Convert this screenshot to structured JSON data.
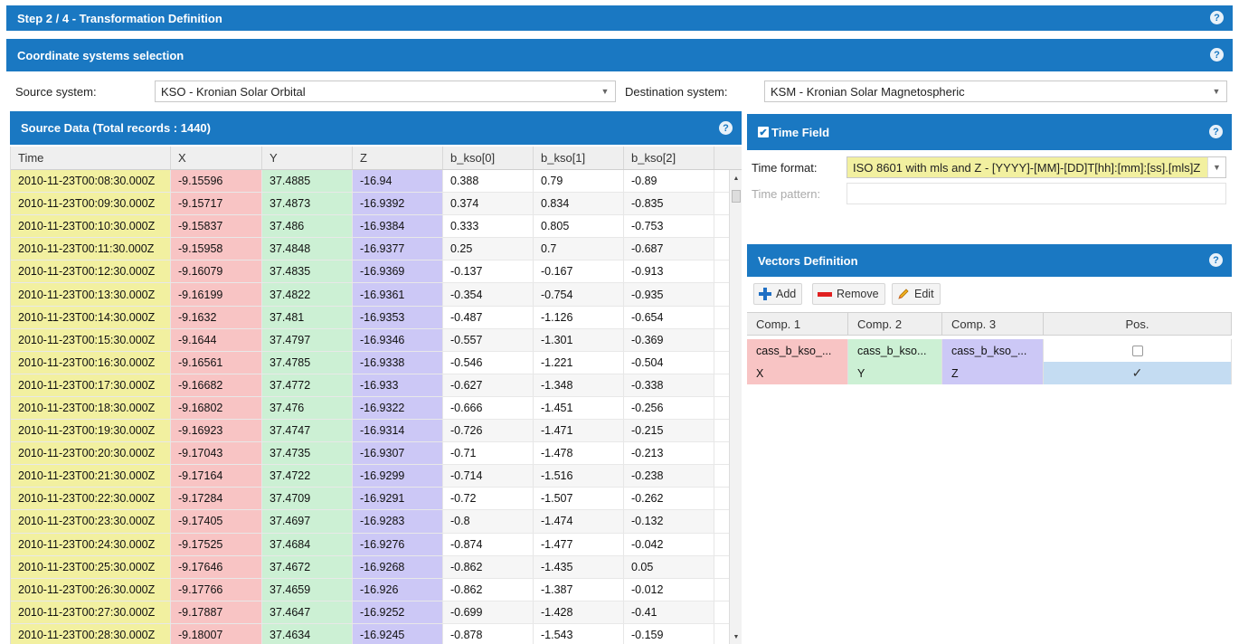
{
  "step": {
    "title": "Step 2 / 4 - Transformation Definition",
    "help": "?"
  },
  "coord": {
    "title": "Coordinate systems selection",
    "help": "?",
    "source_label": "Source system:",
    "source_value": "KSO - Kronian Solar Orbital",
    "dest_label": "Destination system:",
    "dest_value": "KSM - Kronian Solar Magnetospheric"
  },
  "source_data": {
    "title": "Source Data (Total records : 1440)",
    "help": "?",
    "columns": [
      "Time",
      "X",
      "Y",
      "Z",
      "b_kso[0]",
      "b_kso[1]",
      "b_kso[2]"
    ],
    "rows": [
      [
        "2010-11-23T00:08:30.000Z",
        "-9.15596",
        "37.4885",
        "-16.94",
        "0.388",
        "0.79",
        "-0.89"
      ],
      [
        "2010-11-23T00:09:30.000Z",
        "-9.15717",
        "37.4873",
        "-16.9392",
        "0.374",
        "0.834",
        "-0.835"
      ],
      [
        "2010-11-23T00:10:30.000Z",
        "-9.15837",
        "37.486",
        "-16.9384",
        "0.333",
        "0.805",
        "-0.753"
      ],
      [
        "2010-11-23T00:11:30.000Z",
        "-9.15958",
        "37.4848",
        "-16.9377",
        "0.25",
        "0.7",
        "-0.687"
      ],
      [
        "2010-11-23T00:12:30.000Z",
        "-9.16079",
        "37.4835",
        "-16.9369",
        "-0.137",
        "-0.167",
        "-0.913"
      ],
      [
        "2010-11-23T00:13:30.000Z",
        "-9.16199",
        "37.4822",
        "-16.9361",
        "-0.354",
        "-0.754",
        "-0.935"
      ],
      [
        "2010-11-23T00:14:30.000Z",
        "-9.1632",
        "37.481",
        "-16.9353",
        "-0.487",
        "-1.126",
        "-0.654"
      ],
      [
        "2010-11-23T00:15:30.000Z",
        "-9.1644",
        "37.4797",
        "-16.9346",
        "-0.557",
        "-1.301",
        "-0.369"
      ],
      [
        "2010-11-23T00:16:30.000Z",
        "-9.16561",
        "37.4785",
        "-16.9338",
        "-0.546",
        "-1.221",
        "-0.504"
      ],
      [
        "2010-11-23T00:17:30.000Z",
        "-9.16682",
        "37.4772",
        "-16.933",
        "-0.627",
        "-1.348",
        "-0.338"
      ],
      [
        "2010-11-23T00:18:30.000Z",
        "-9.16802",
        "37.476",
        "-16.9322",
        "-0.666",
        "-1.451",
        "-0.256"
      ],
      [
        "2010-11-23T00:19:30.000Z",
        "-9.16923",
        "37.4747",
        "-16.9314",
        "-0.726",
        "-1.471",
        "-0.215"
      ],
      [
        "2010-11-23T00:20:30.000Z",
        "-9.17043",
        "37.4735",
        "-16.9307",
        "-0.71",
        "-1.478",
        "-0.213"
      ],
      [
        "2010-11-23T00:21:30.000Z",
        "-9.17164",
        "37.4722",
        "-16.9299",
        "-0.714",
        "-1.516",
        "-0.238"
      ],
      [
        "2010-11-23T00:22:30.000Z",
        "-9.17284",
        "37.4709",
        "-16.9291",
        "-0.72",
        "-1.507",
        "-0.262"
      ],
      [
        "2010-11-23T00:23:30.000Z",
        "-9.17405",
        "37.4697",
        "-16.9283",
        "-0.8",
        "-1.474",
        "-0.132"
      ],
      [
        "2010-11-23T00:24:30.000Z",
        "-9.17525",
        "37.4684",
        "-16.9276",
        "-0.874",
        "-1.477",
        "-0.042"
      ],
      [
        "2010-11-23T00:25:30.000Z",
        "-9.17646",
        "37.4672",
        "-16.9268",
        "-0.862",
        "-1.435",
        "0.05"
      ],
      [
        "2010-11-23T00:26:30.000Z",
        "-9.17766",
        "37.4659",
        "-16.926",
        "-0.862",
        "-1.387",
        "-0.012"
      ],
      [
        "2010-11-23T00:27:30.000Z",
        "-9.17887",
        "37.4647",
        "-16.9252",
        "-0.699",
        "-1.428",
        "-0.41"
      ],
      [
        "2010-11-23T00:28:30.000Z",
        "-9.18007",
        "37.4634",
        "-16.9245",
        "-0.878",
        "-1.543",
        "-0.159"
      ]
    ]
  },
  "time_field": {
    "title": "Time Field",
    "checked_glyph": "✔",
    "help": "?",
    "format_label": "Time format:",
    "format_value": "ISO 8601 with mls and Z - [YYYY]-[MM]-[DD]T[hh]:[mm]:[ss].[mls]Z",
    "pattern_label": "Time pattern:",
    "pattern_value": ""
  },
  "vectors": {
    "title": "Vectors Definition",
    "help": "?",
    "add_label": "Add",
    "remove_label": "Remove",
    "edit_label": "Edit",
    "columns": [
      "Comp. 1",
      "Comp. 2",
      "Comp. 3",
      "Pos."
    ],
    "rows": [
      {
        "c1": "cass_b_kso_...",
        "c2": "cass_b_kso...",
        "c3": "cass_b_kso_...",
        "pos": false
      },
      {
        "c1": "X",
        "c2": "Y",
        "c3": "Z",
        "pos": true
      }
    ]
  },
  "colors": {
    "header_blue": "#1a78c2",
    "time_col": "#f2f0a0",
    "x_col": "#f8c4c4",
    "y_col": "#ccf0d4",
    "z_col": "#ccc8f6"
  }
}
